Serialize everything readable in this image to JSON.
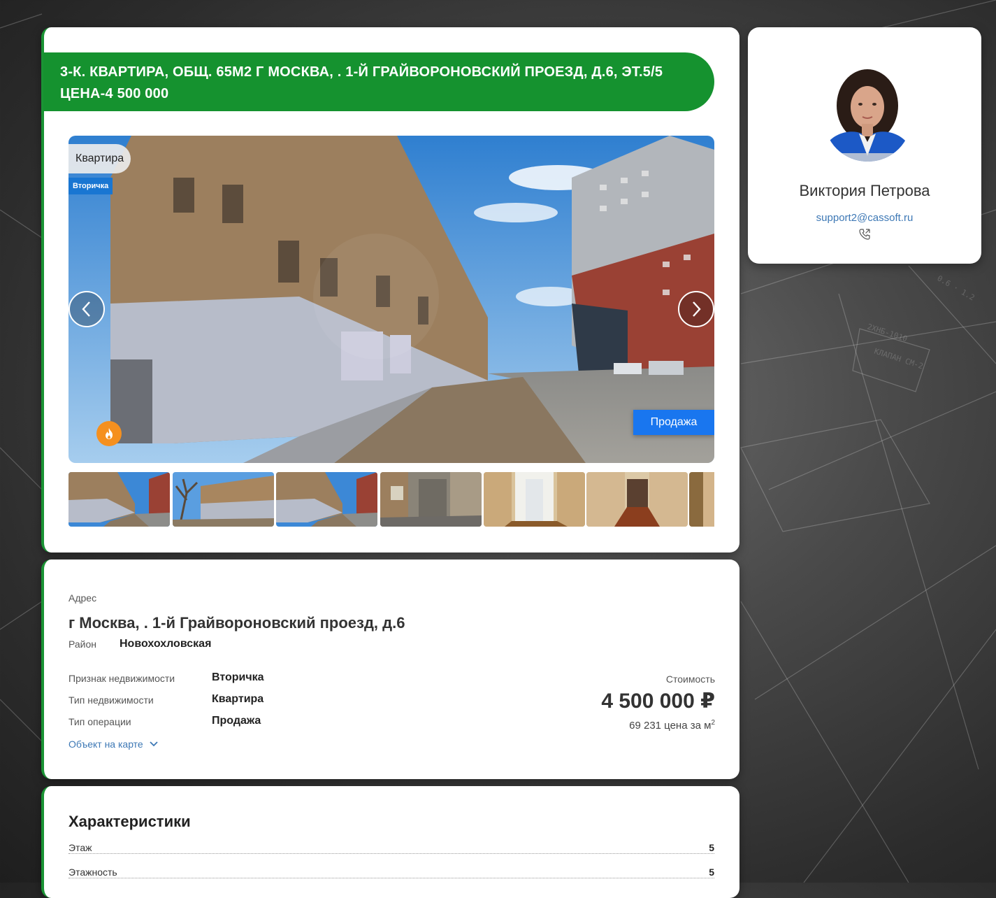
{
  "listing": {
    "title": "3-К. КВАРТИРА, ОБЩ. 65М2 Г МОСКВА, . 1-Й ГРАЙВОРОНОВСКИЙ ПРОЕЗД, Д.6, ЭТ.5/5 ЦЕНА-4 500 000",
    "type_tag": "Квартира",
    "market_tag": "Вторичка",
    "deal_badge": "Продажа",
    "thumbnail_count": 7
  },
  "address": {
    "label": "Адрес",
    "value": "г Москва, . 1-й Грайвороновский проезд, д.6",
    "district_label": "Район",
    "district_value": "Новохохловская",
    "props": [
      {
        "label": "Признак недвижимости",
        "value": "Вторичка"
      },
      {
        "label": "Тип недвижимости",
        "value": "Квартира"
      },
      {
        "label": "Тип операции",
        "value": "Продажа"
      }
    ],
    "map_link": "Объект на карте",
    "price_label": "Стоимость",
    "price": "4 500 000 ₽",
    "price_per_m2": "69 231 цена за м",
    "price_per_m2_sup": "2"
  },
  "characteristics": {
    "title": "Характеристики",
    "rows": [
      {
        "label": "Этаж",
        "value": "5"
      },
      {
        "label": "Этажность",
        "value": "5"
      }
    ]
  },
  "agent": {
    "name": "Виктория Петрова",
    "email": "support2@cassoft.ru"
  },
  "colors": {
    "accent_green": "#15922f",
    "badge_blue": "#1976ef",
    "link_blue": "#3d78b5"
  }
}
